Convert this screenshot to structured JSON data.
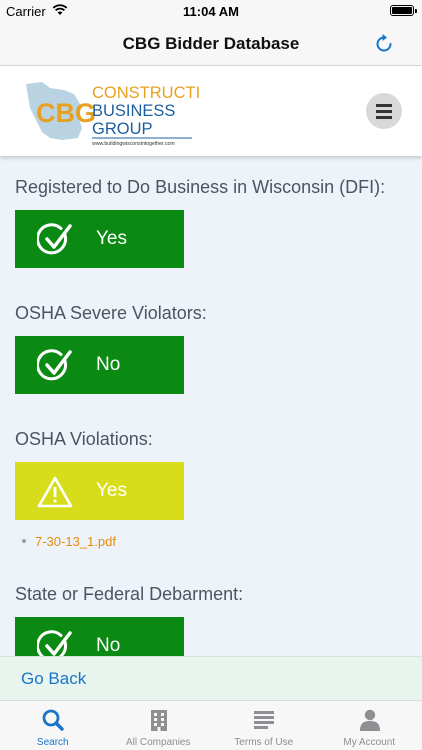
{
  "status_bar": {
    "carrier": "Carrier",
    "time": "11:04 AM"
  },
  "nav": {
    "title": "CBG Bidder Database",
    "refresh_icon": "refresh-icon"
  },
  "header": {
    "logo": {
      "initials": "CBG",
      "line1": "CONSTRUCTION",
      "line2": "BUSINESS",
      "line3": "GROUP",
      "url": "www.buildingwisconsintogether.com"
    },
    "menu_icon": "hamburger-menu-icon"
  },
  "sections": [
    {
      "label": "Registered to Do Business in Wisconsin (DFI):",
      "value": "Yes",
      "status": "ok"
    },
    {
      "label": "OSHA Severe Violators:",
      "value": "No",
      "status": "ok"
    },
    {
      "label": "OSHA Violations:",
      "value": "Yes",
      "status": "warning",
      "attachments": [
        "7-30-13_1.pdf"
      ]
    },
    {
      "label": "State or Federal Debarment:",
      "value": "No",
      "status": "ok"
    }
  ],
  "go_back": {
    "label": "Go Back"
  },
  "tabs": [
    {
      "label": "Search",
      "icon": "search-icon",
      "active": true
    },
    {
      "label": "All Companies",
      "icon": "building-icon",
      "active": false
    },
    {
      "label": "Terms of Use",
      "icon": "document-lines-icon",
      "active": false
    },
    {
      "label": "My Account",
      "icon": "person-icon",
      "active": false
    }
  ],
  "colors": {
    "status_green": "#0b8a13",
    "status_yellow": "#d8dd1b",
    "accent_blue": "#1a74c9",
    "link_orange": "#e58b10",
    "logo_orange": "#e8a020",
    "logo_blue": "#1c5f9e",
    "page_background": "#eef3f9"
  }
}
